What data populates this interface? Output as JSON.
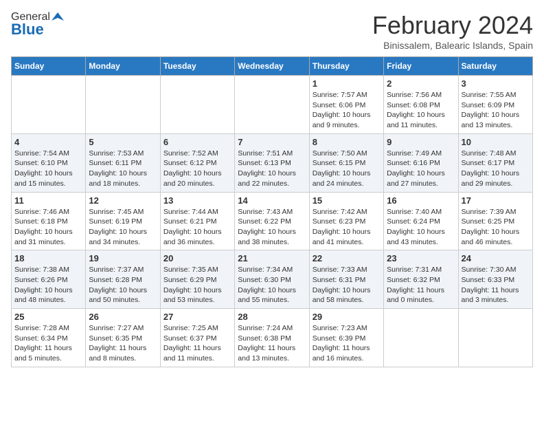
{
  "header": {
    "logo_general": "General",
    "logo_blue": "Blue",
    "month_title": "February 2024",
    "location": "Binissalem, Balearic Islands, Spain"
  },
  "days_of_week": [
    "Sunday",
    "Monday",
    "Tuesday",
    "Wednesday",
    "Thursday",
    "Friday",
    "Saturday"
  ],
  "weeks": [
    [
      {
        "day": "",
        "info": ""
      },
      {
        "day": "",
        "info": ""
      },
      {
        "day": "",
        "info": ""
      },
      {
        "day": "",
        "info": ""
      },
      {
        "day": "1",
        "info": "Sunrise: 7:57 AM\nSunset: 6:06 PM\nDaylight: 10 hours and 9 minutes."
      },
      {
        "day": "2",
        "info": "Sunrise: 7:56 AM\nSunset: 6:08 PM\nDaylight: 10 hours and 11 minutes."
      },
      {
        "day": "3",
        "info": "Sunrise: 7:55 AM\nSunset: 6:09 PM\nDaylight: 10 hours and 13 minutes."
      }
    ],
    [
      {
        "day": "4",
        "info": "Sunrise: 7:54 AM\nSunset: 6:10 PM\nDaylight: 10 hours and 15 minutes."
      },
      {
        "day": "5",
        "info": "Sunrise: 7:53 AM\nSunset: 6:11 PM\nDaylight: 10 hours and 18 minutes."
      },
      {
        "day": "6",
        "info": "Sunrise: 7:52 AM\nSunset: 6:12 PM\nDaylight: 10 hours and 20 minutes."
      },
      {
        "day": "7",
        "info": "Sunrise: 7:51 AM\nSunset: 6:13 PM\nDaylight: 10 hours and 22 minutes."
      },
      {
        "day": "8",
        "info": "Sunrise: 7:50 AM\nSunset: 6:15 PM\nDaylight: 10 hours and 24 minutes."
      },
      {
        "day": "9",
        "info": "Sunrise: 7:49 AM\nSunset: 6:16 PM\nDaylight: 10 hours and 27 minutes."
      },
      {
        "day": "10",
        "info": "Sunrise: 7:48 AM\nSunset: 6:17 PM\nDaylight: 10 hours and 29 minutes."
      }
    ],
    [
      {
        "day": "11",
        "info": "Sunrise: 7:46 AM\nSunset: 6:18 PM\nDaylight: 10 hours and 31 minutes."
      },
      {
        "day": "12",
        "info": "Sunrise: 7:45 AM\nSunset: 6:19 PM\nDaylight: 10 hours and 34 minutes."
      },
      {
        "day": "13",
        "info": "Sunrise: 7:44 AM\nSunset: 6:21 PM\nDaylight: 10 hours and 36 minutes."
      },
      {
        "day": "14",
        "info": "Sunrise: 7:43 AM\nSunset: 6:22 PM\nDaylight: 10 hours and 38 minutes."
      },
      {
        "day": "15",
        "info": "Sunrise: 7:42 AM\nSunset: 6:23 PM\nDaylight: 10 hours and 41 minutes."
      },
      {
        "day": "16",
        "info": "Sunrise: 7:40 AM\nSunset: 6:24 PM\nDaylight: 10 hours and 43 minutes."
      },
      {
        "day": "17",
        "info": "Sunrise: 7:39 AM\nSunset: 6:25 PM\nDaylight: 10 hours and 46 minutes."
      }
    ],
    [
      {
        "day": "18",
        "info": "Sunrise: 7:38 AM\nSunset: 6:26 PM\nDaylight: 10 hours and 48 minutes."
      },
      {
        "day": "19",
        "info": "Sunrise: 7:37 AM\nSunset: 6:28 PM\nDaylight: 10 hours and 50 minutes."
      },
      {
        "day": "20",
        "info": "Sunrise: 7:35 AM\nSunset: 6:29 PM\nDaylight: 10 hours and 53 minutes."
      },
      {
        "day": "21",
        "info": "Sunrise: 7:34 AM\nSunset: 6:30 PM\nDaylight: 10 hours and 55 minutes."
      },
      {
        "day": "22",
        "info": "Sunrise: 7:33 AM\nSunset: 6:31 PM\nDaylight: 10 hours and 58 minutes."
      },
      {
        "day": "23",
        "info": "Sunrise: 7:31 AM\nSunset: 6:32 PM\nDaylight: 11 hours and 0 minutes."
      },
      {
        "day": "24",
        "info": "Sunrise: 7:30 AM\nSunset: 6:33 PM\nDaylight: 11 hours and 3 minutes."
      }
    ],
    [
      {
        "day": "25",
        "info": "Sunrise: 7:28 AM\nSunset: 6:34 PM\nDaylight: 11 hours and 5 minutes."
      },
      {
        "day": "26",
        "info": "Sunrise: 7:27 AM\nSunset: 6:35 PM\nDaylight: 11 hours and 8 minutes."
      },
      {
        "day": "27",
        "info": "Sunrise: 7:25 AM\nSunset: 6:37 PM\nDaylight: 11 hours and 11 minutes."
      },
      {
        "day": "28",
        "info": "Sunrise: 7:24 AM\nSunset: 6:38 PM\nDaylight: 11 hours and 13 minutes."
      },
      {
        "day": "29",
        "info": "Sunrise: 7:23 AM\nSunset: 6:39 PM\nDaylight: 11 hours and 16 minutes."
      },
      {
        "day": "",
        "info": ""
      },
      {
        "day": "",
        "info": ""
      }
    ]
  ]
}
